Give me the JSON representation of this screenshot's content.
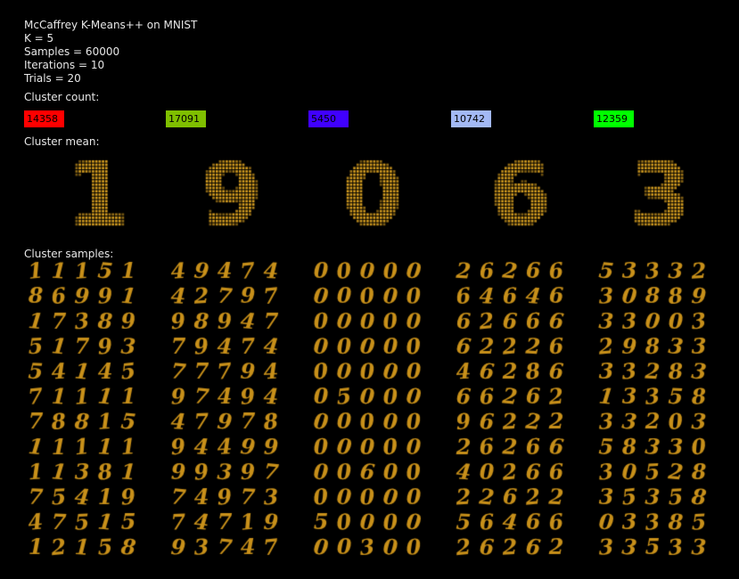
{
  "header": {
    "title": "McCaffrey K-Means++ on MNIST",
    "k": "K = 5",
    "samples": "Samples = 60000",
    "iterations": "Iterations = 10",
    "trials": "Trials = 20"
  },
  "labels": {
    "cluster_count": "Cluster count:",
    "cluster_mean": "Cluster mean:",
    "cluster_samples": "Cluster samples:"
  },
  "colors": {
    "digit": "#c8901a",
    "mean": "#d09a20"
  },
  "clusters": [
    {
      "count": "14358",
      "color": "#ff0000",
      "mean_digit": "1",
      "samples": [
        "11151",
        "86991",
        "17389",
        "51793",
        "54145",
        "71111",
        "78815",
        "11111",
        "11381",
        "75419",
        "47515",
        "12158"
      ]
    },
    {
      "count": "17091",
      "color": "#7fbf00",
      "mean_digit": "9",
      "samples": [
        "49474",
        "42797",
        "98947",
        "79474",
        "77794",
        "97494",
        "47978",
        "94499",
        "99397",
        "74973",
        "74719",
        "93747"
      ]
    },
    {
      "count": "5450",
      "color": "#4000ff",
      "mean_digit": "0",
      "samples": [
        "00000",
        "00000",
        "00000",
        "00000",
        "00000",
        "05000",
        "00000",
        "00000",
        "00600",
        "00000",
        "50000",
        "00300"
      ]
    },
    {
      "count": "10742",
      "color": "#a3b9f5",
      "mean_digit": "6",
      "samples": [
        "26266",
        "64646",
        "62666",
        "62226",
        "46286",
        "66262",
        "96222",
        "26266",
        "40266",
        "22622",
        "56466",
        "26262"
      ]
    },
    {
      "count": "12359",
      "color": "#00ff00",
      "mean_digit": "3",
      "samples": [
        "53332",
        "30889",
        "33003",
        "29833",
        "33283",
        "13358",
        "33203",
        "58330",
        "30528",
        "35358",
        "03385",
        "33533"
      ]
    }
  ]
}
